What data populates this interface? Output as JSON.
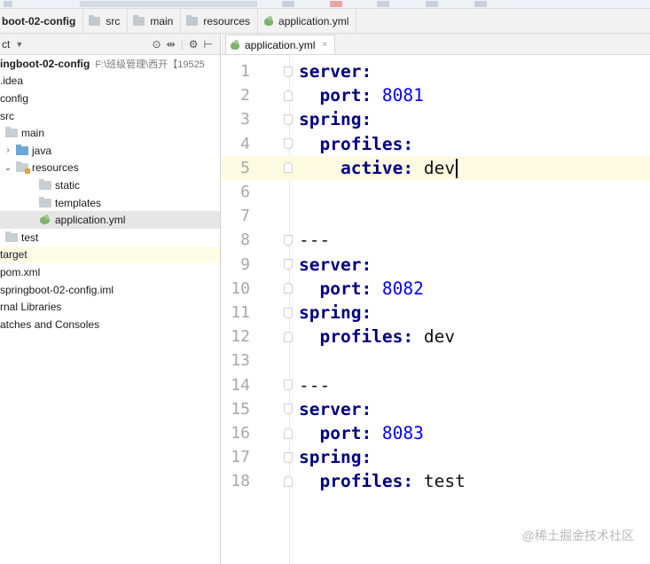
{
  "breadcrumb": {
    "items": [
      "boot-02-config",
      "src",
      "main",
      "resources",
      "application.yml"
    ]
  },
  "sidebar": {
    "toolbar_label": "ct",
    "tree": [
      {
        "label": "ingboot-02-config",
        "path": "F:\\班级管理\\西开【19525"
      },
      {
        "label": ".idea"
      },
      {
        "label": "config"
      },
      {
        "label": "src"
      },
      {
        "label": "main"
      },
      {
        "label": "java"
      },
      {
        "label": "resources"
      },
      {
        "label": "static"
      },
      {
        "label": "templates"
      },
      {
        "label": "application.yml"
      },
      {
        "label": "test"
      },
      {
        "label": "target"
      },
      {
        "label": "pom.xml"
      },
      {
        "label": "springboot-02-config.iml"
      },
      {
        "label": "rnal Libraries"
      },
      {
        "label": "atches and Consoles"
      }
    ]
  },
  "editor": {
    "tab_label": "application.yml",
    "lines": [
      {
        "num": "1",
        "key": "server:"
      },
      {
        "num": "2",
        "key": "port:",
        "val": "8081",
        "valtype": "num"
      },
      {
        "num": "3",
        "key": "spring:"
      },
      {
        "num": "4",
        "key": "profiles:"
      },
      {
        "num": "5",
        "key": "active:",
        "val": "dev",
        "valtype": "str"
      },
      {
        "num": "6"
      },
      {
        "num": "7"
      },
      {
        "num": "8",
        "doc": "---"
      },
      {
        "num": "9",
        "key": "server:"
      },
      {
        "num": "10",
        "key": "port:",
        "val": "8082",
        "valtype": "num"
      },
      {
        "num": "11",
        "key": "spring:"
      },
      {
        "num": "12",
        "key": "profiles:",
        "val": "dev",
        "valtype": "str"
      },
      {
        "num": "13"
      },
      {
        "num": "14",
        "doc": "---"
      },
      {
        "num": "15",
        "key": "server:"
      },
      {
        "num": "16",
        "key": "port:",
        "val": "8083",
        "valtype": "num"
      },
      {
        "num": "17",
        "key": "spring:"
      },
      {
        "num": "18",
        "key": "profiles:",
        "val": "test",
        "valtype": "str"
      }
    ]
  },
  "watermark": "@稀土掘金技术社区"
}
